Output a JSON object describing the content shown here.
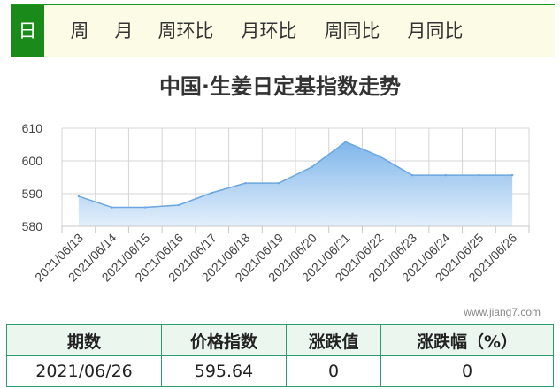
{
  "tabs": [
    {
      "label": "日",
      "active": true
    },
    {
      "label": "周",
      "active": false
    },
    {
      "label": "月",
      "active": false
    },
    {
      "label": "周环比",
      "active": false
    },
    {
      "label": "月环比",
      "active": false
    },
    {
      "label": "周同比",
      "active": false
    },
    {
      "label": "月同比",
      "active": false
    }
  ],
  "colors": {
    "accent": "#1a8a1a",
    "area_top": "#7fb6ea",
    "area_bottom": "#e3effb",
    "line": "#6aa6e0",
    "table_border": "#2f9b70"
  },
  "watermark": "www.jiang7.com",
  "chart_data": {
    "type": "area",
    "title": "中国·生姜日定基指数走势",
    "xlabel": "",
    "ylabel": "",
    "x": [
      "2021/06/13",
      "2021/06/14",
      "2021/06/15",
      "2021/06/16",
      "2021/06/17",
      "2021/06/18",
      "2021/06/19",
      "2021/06/20",
      "2021/06/21",
      "2021/06/22",
      "2021/06/23",
      "2021/06/24",
      "2021/06/25",
      "2021/06/26"
    ],
    "values": [
      589.2,
      585.8,
      585.8,
      586.5,
      590.3,
      593.2,
      593.2,
      598.2,
      605.8,
      601.5,
      595.64,
      595.64,
      595.64,
      595.64
    ],
    "ylim": [
      580,
      610
    ],
    "yticks": [
      580,
      590,
      600,
      610
    ],
    "grid": true
  },
  "table": {
    "headers": [
      "期数",
      "价格指数",
      "涨跌值",
      "涨跌幅（%）"
    ],
    "row": [
      "2021/06/26",
      "595.64",
      "0",
      "0"
    ]
  }
}
